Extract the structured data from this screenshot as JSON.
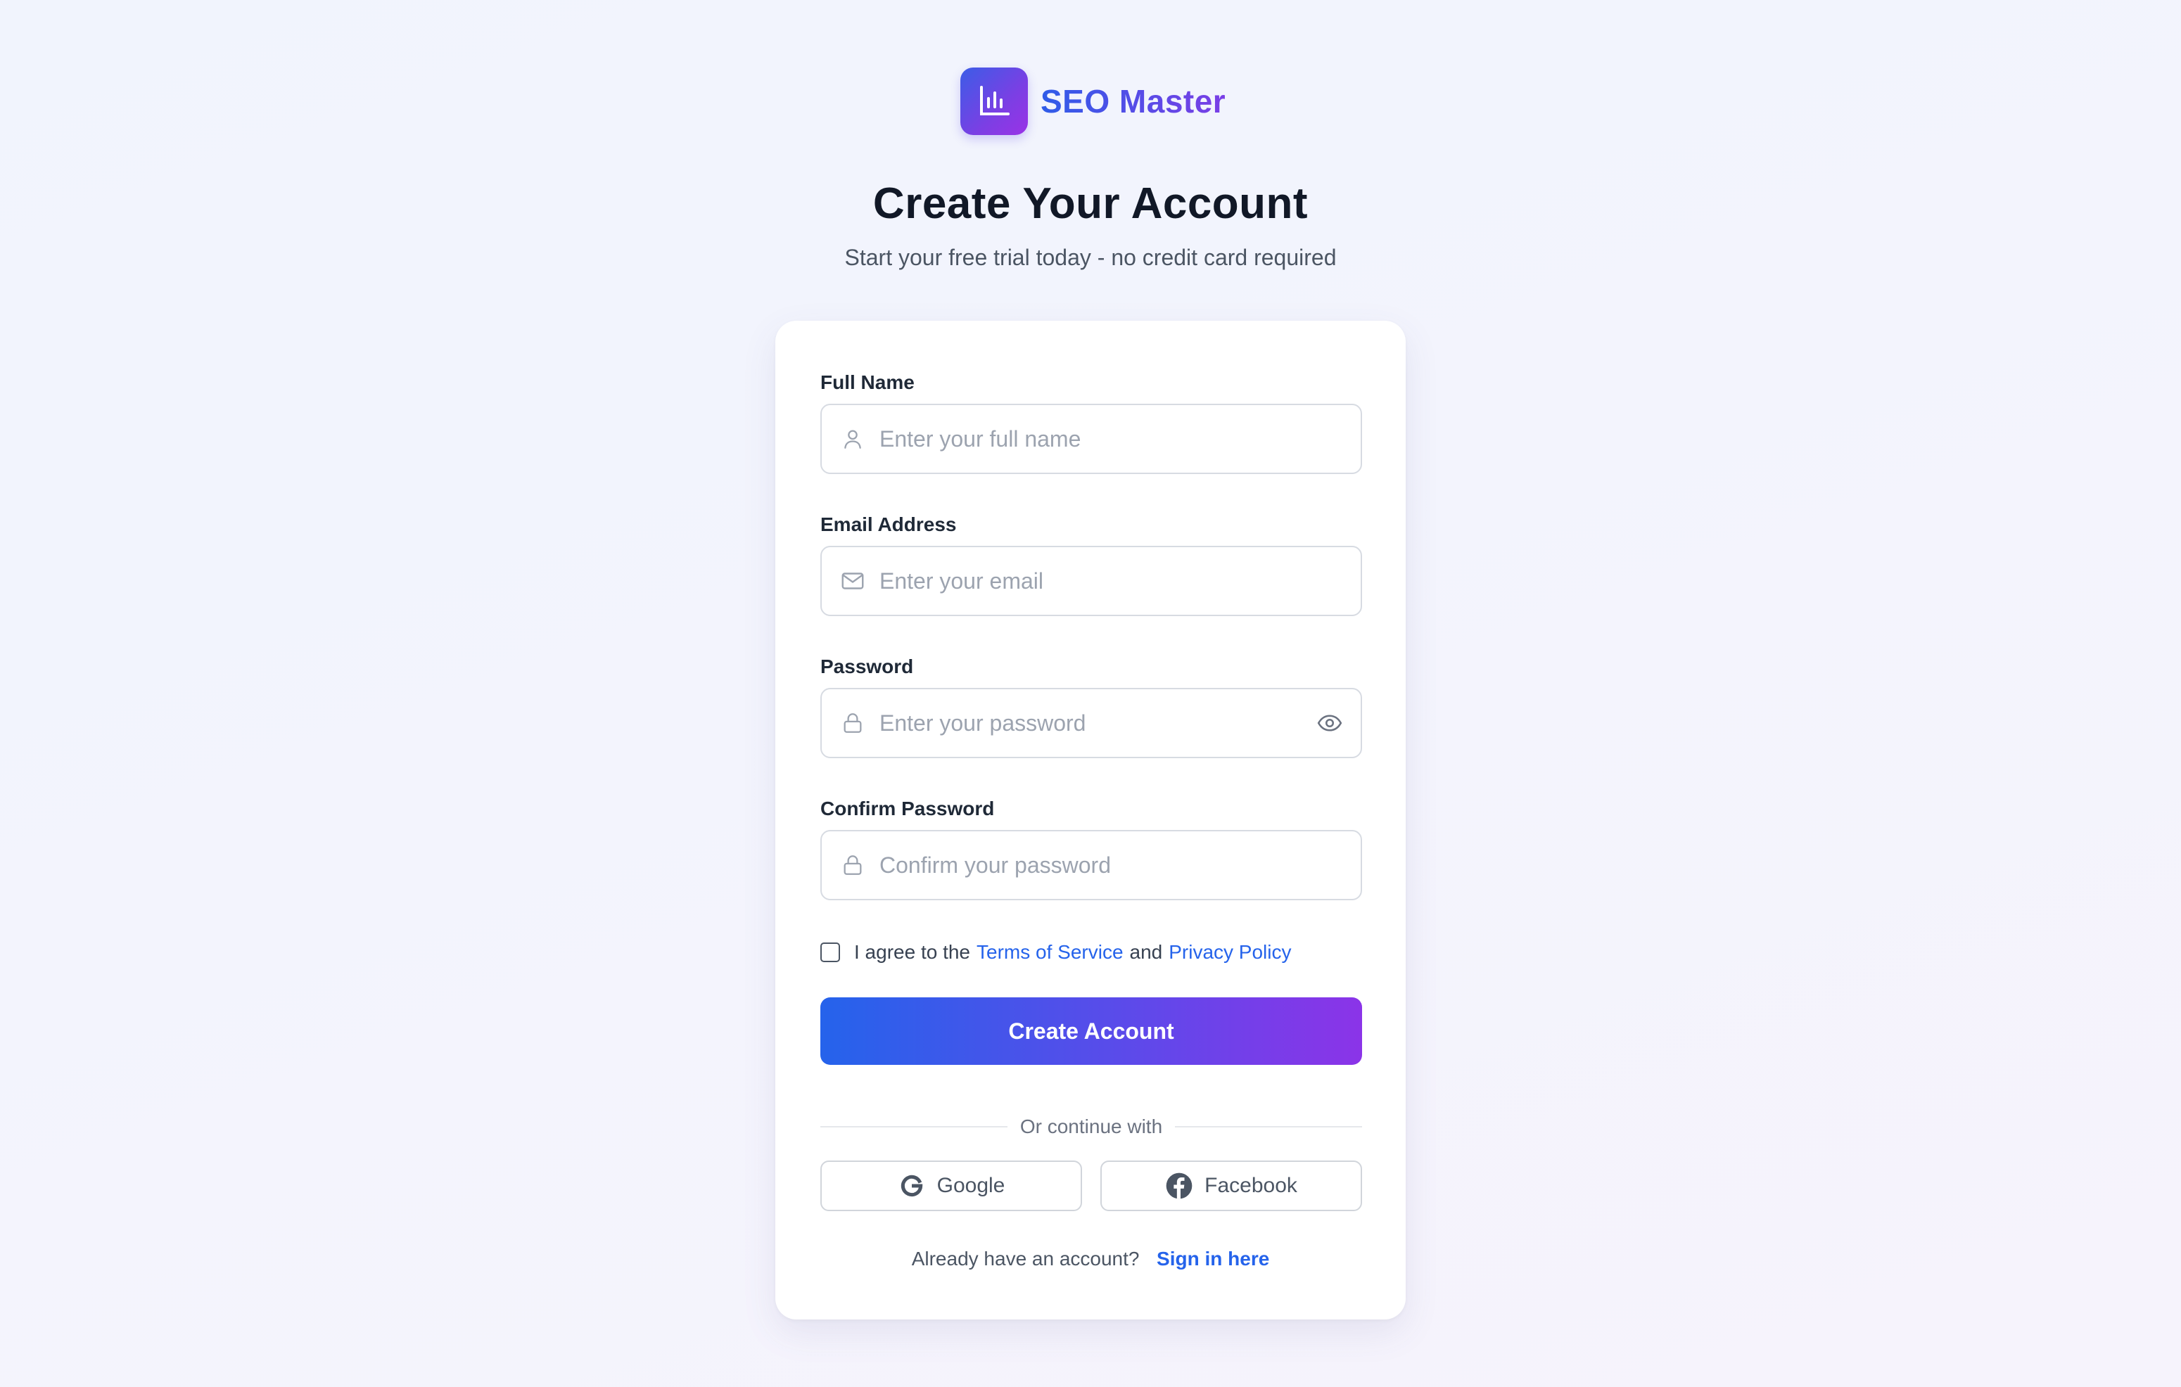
{
  "brand": {
    "name": "SEO Master",
    "logo_icon": "bar-chart-icon",
    "gradient_start": "#3b5de7",
    "gradient_end": "#9a32e6"
  },
  "header": {
    "title": "Create Your Account",
    "subtitle": "Start your free trial today - no credit card required"
  },
  "form": {
    "full_name": {
      "label": "Full Name",
      "placeholder": "Enter your full name",
      "value": "",
      "icon": "user-icon"
    },
    "email": {
      "label": "Email Address",
      "placeholder": "Enter your email",
      "value": "",
      "icon": "mail-icon"
    },
    "password": {
      "label": "Password",
      "placeholder": "Enter your password",
      "value": "",
      "icon": "lock-icon",
      "toggle_icon": "eye-icon"
    },
    "confirm_password": {
      "label": "Confirm Password",
      "placeholder": "Confirm your password",
      "value": "",
      "icon": "lock-icon"
    },
    "agree": {
      "checked": false,
      "prefix": "I agree to the",
      "terms_link": "Terms of Service",
      "middle": "and",
      "privacy_link": "Privacy Policy"
    },
    "submit_label": "Create Account"
  },
  "divider_text": "Or continue with",
  "social": {
    "google_label": "Google",
    "google_icon": "google-icon",
    "facebook_label": "Facebook",
    "facebook_icon": "facebook-icon"
  },
  "footer": {
    "prompt": "Already have an account?",
    "signin_link": "Sign in here"
  },
  "colors": {
    "accent_blue": "#2563eb",
    "accent_purple": "#8b34e8",
    "link": "#2563eb"
  }
}
